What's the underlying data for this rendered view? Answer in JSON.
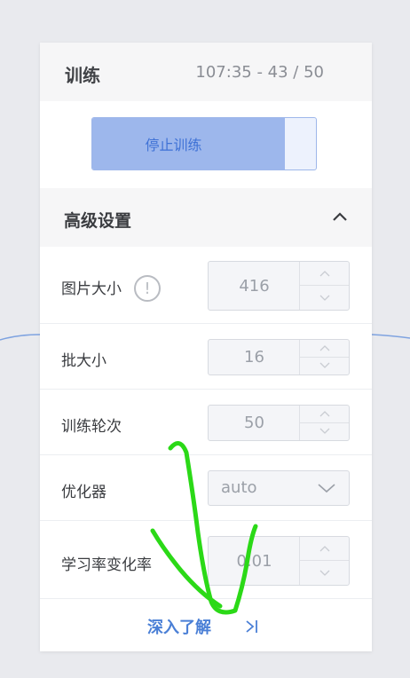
{
  "panel": {
    "title": "训练",
    "progress": "107:35 - 43 / 50"
  },
  "stop_button": {
    "label": "停止训练",
    "fill_fraction": 0.86
  },
  "advanced": {
    "title": "高级设置",
    "rows": [
      {
        "label": "图片大小",
        "value": "416",
        "has_info": true
      },
      {
        "label": "批大小",
        "value": "16"
      },
      {
        "label": "训练轮次",
        "value": "50"
      },
      {
        "label": "优化器",
        "value": "auto"
      },
      {
        "label": "学习率变化率",
        "value": "0.01"
      }
    ]
  },
  "learn_more": {
    "label": "深入了解"
  },
  "icons": {
    "info": "info-icon",
    "caret": "chevron-up-icon",
    "select": "chevron-down-icon",
    "learn": "skip-forward-icon"
  },
  "colors": {
    "accent": "#4a7fd6",
    "button_fill": "#9db7ec",
    "scribble": "#2bd917"
  }
}
